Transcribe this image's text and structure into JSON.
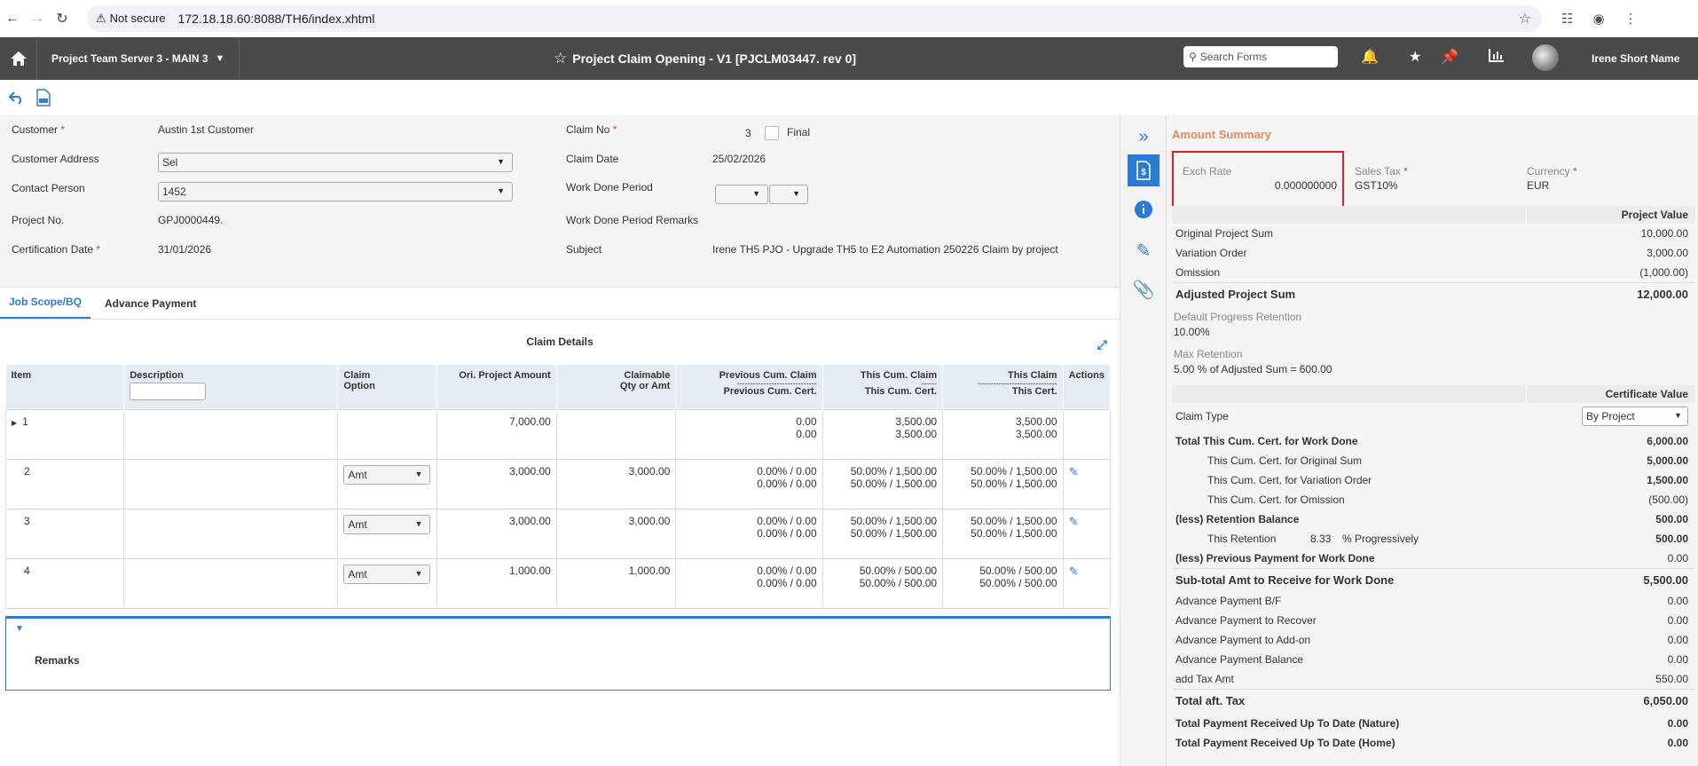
{
  "browser": {
    "security": "Not secure",
    "url": "172.18.18.60:8088/TH6/index.xhtml"
  },
  "header": {
    "server": "Project Team Server 3 - MAIN 3",
    "title": "Project Claim Opening - V1 [PJCLM03447. rev 0]",
    "search_placeholder": "Search Forms",
    "user": "Irene Short Name"
  },
  "form": {
    "customer_label": "Customer",
    "customer_value": "Austin 1st Customer",
    "address_label": "Customer Address",
    "address_value": "Sel",
    "contact_label": "Contact Person",
    "contact_value": "1452",
    "project_label": "Project No.",
    "project_value": "GPJ0000449.",
    "cert_date_label": "Certification Date",
    "cert_date_value": "31/01/2026",
    "claim_no_label": "Claim No",
    "claim_no_value": "3",
    "final_label": "Final",
    "claim_date_label": "Claim Date",
    "claim_date_value": "25/02/2026",
    "work_done_label": "Work Done Period",
    "work_done_remarks_label": "Work Done Period Remarks",
    "subject_label": "Subject",
    "subject_value": "Irene TH5 PJO - Upgrade TH5 to E2 Automation 250226 Claim by project"
  },
  "tabs": [
    "Job Scope/BQ",
    "Advance Payment"
  ],
  "claim_details": {
    "title": "Claim Details",
    "headers": {
      "item": "Item",
      "description": "Description",
      "claim_option_1": "Claim",
      "claim_option_2": "Option",
      "ori_amount": "Ori. Project Amount",
      "claimable_1": "Claimable",
      "claimable_2": "Qty or Amt",
      "prev_1": "Previous Cum. Claim",
      "prev_sep": "------------------------------",
      "prev_2": "Previous Cum. Cert.",
      "this_cum_1": "This Cum. Claim",
      "this_cum_sep": "------",
      "this_cum_2": "This Cum. Cert.",
      "this_claim_1": "This Claim",
      "this_claim_sep": "------------------------------",
      "this_claim_2": "This Cert.",
      "actions": "Actions"
    },
    "rows": [
      {
        "item": "1",
        "option": "",
        "ori": "7,000.00",
        "claimable": "",
        "prev_a": "0.00",
        "prev_b": "0.00",
        "cum_a": "3,500.00",
        "cum_b": "3,500.00",
        "claim_a": "3,500.00",
        "claim_b": "3,500.00"
      },
      {
        "item": "2",
        "option": "Amt",
        "ori": "3,000.00",
        "claimable": "3,000.00",
        "prev_a": "0.00% / 0.00",
        "prev_b": "0.00% / 0.00",
        "cum_a": "50.00% / 1,500.00",
        "cum_b": "50.00% / 1,500.00",
        "claim_a": "50.00% / 1,500.00",
        "claim_b": "50.00% / 1,500.00"
      },
      {
        "item": "3",
        "option": "Amt",
        "ori": "3,000.00",
        "claimable": "3,000.00",
        "prev_a": "0.00% / 0.00",
        "prev_b": "0.00% / 0.00",
        "cum_a": "50.00% / 1,500.00",
        "cum_b": "50.00% / 1,500.00",
        "claim_a": "50.00% / 1,500.00",
        "claim_b": "50.00% / 1,500.00"
      },
      {
        "item": "4",
        "option": "Amt",
        "ori": "1,000.00",
        "claimable": "1,000.00",
        "prev_a": "0.00% / 0.00",
        "prev_b": "0.00% / 0.00",
        "cum_a": "50.00% / 500.00",
        "cum_b": "50.00% / 500.00",
        "claim_a": "50.00% / 500.00",
        "claim_b": "50.00% / 500.00"
      }
    ],
    "remarks_label": "Remarks"
  },
  "summary": {
    "title": "Amount Summary",
    "exch_rate_label": "Exch Rate",
    "exch_rate_value": "0.000000000",
    "sales_tax_label": "Sales Tax",
    "sales_tax_value": "GST10%",
    "currency_label": "Currency",
    "currency_value": "EUR",
    "project_value_head": "Project Value",
    "original_sum_label": "Original Project Sum",
    "original_sum_value": "10,000.00",
    "variation_label": "Variation Order",
    "variation_value": "3,000.00",
    "omission_label": "Omission",
    "omission_value": "(1,000.00)",
    "adjusted_label": "Adjusted Project Sum",
    "adjusted_value": "12,000.00",
    "default_ret_label": "Default Progress Retention",
    "default_ret_value": "10.00%",
    "max_ret_label": "Max Retention",
    "max_ret_value": "5.00 % of Adjusted Sum = 600.00",
    "cert_value_head": "Certificate Value",
    "claim_type_label": "Claim Type",
    "claim_type_value": "By Project",
    "total_cum_label": "Total This Cum. Cert. for Work Done",
    "total_cum_value": "6,000.00",
    "cum_orig_label": "This Cum. Cert. for Original Sum",
    "cum_orig_value": "5,000.00",
    "cum_var_label": "This Cum. Cert. for Variation Order",
    "cum_var_value": "1,500.00",
    "cum_om_label": "This Cum. Cert. for Omission",
    "cum_om_value": "(500.00)",
    "ret_bal_label": "(less) Retention Balance",
    "ret_bal_value": "500.00",
    "this_ret_label": "This Retention",
    "this_ret_pct": "8.33",
    "this_ret_suffix": "% Progressively",
    "this_ret_value": "500.00",
    "prev_pay_label": "(less) Previous Payment for Work Done",
    "prev_pay_value": "0.00",
    "subtotal_label": "Sub-total Amt to Receive for Work Done",
    "subtotal_value": "5,500.00",
    "adv_bf_label": "Advance Payment B/F",
    "adv_bf_value": "0.00",
    "adv_recover_label": "Advance Payment to Recover",
    "adv_recover_value": "0.00",
    "adv_addon_label": "Advance Payment to Add-on",
    "adv_addon_value": "0.00",
    "adv_bal_label": "Advance Payment Balance",
    "adv_bal_value": "0.00",
    "tax_label": "add Tax Amt",
    "tax_value": "550.00",
    "total_tax_label": "Total aft. Tax",
    "total_tax_value": "6,050.00",
    "recv_nature_label": "Total Payment Received Up To Date (Nature)",
    "recv_nature_value": "0.00",
    "recv_home_label": "Total Payment Received Up To Date (Home)",
    "recv_home_value": "0.00"
  }
}
